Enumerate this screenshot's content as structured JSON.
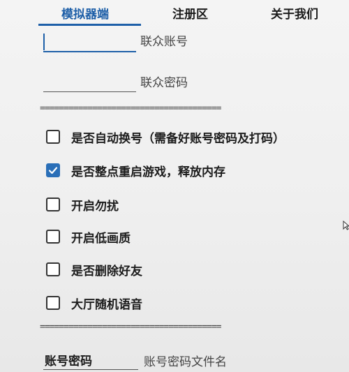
{
  "tabs": [
    {
      "label": "模拟器端",
      "active": true
    },
    {
      "label": "注册区",
      "active": false
    },
    {
      "label": "关于我们",
      "active": false
    }
  ],
  "account": {
    "label": "联众账号",
    "value": ""
  },
  "password": {
    "label": "联众密码",
    "value": ""
  },
  "separator": "======================================",
  "options": [
    {
      "label": "是否自动换号（需备好账号密码及打码）",
      "checked": false
    },
    {
      "label": "是否整点重启游戏，释放内存",
      "checked": true
    },
    {
      "label": "开启勿扰",
      "checked": false
    },
    {
      "label": "开启低画质",
      "checked": false
    },
    {
      "label": "是否删除好友",
      "checked": false
    },
    {
      "label": "大厅随机语音",
      "checked": false
    }
  ],
  "account_file": {
    "value": "账号密码",
    "label": "账号密码文件名"
  },
  "colors": {
    "accent": "#1e5fa8",
    "checkbox_checked": "#2a6fb8"
  }
}
